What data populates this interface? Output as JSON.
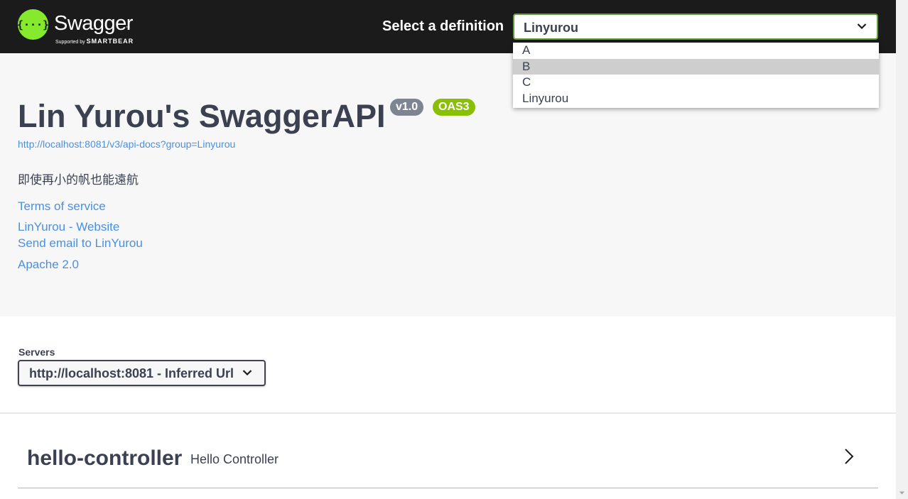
{
  "header": {
    "logo_word": "Swagger",
    "logo_tm": "™",
    "logo_sub_prefix": "Supported by",
    "logo_sub_brand": "SMARTBEAR",
    "definition_label": "Select a definition",
    "definition_value": "Linyurou",
    "definition_options": [
      "A",
      "B",
      "C",
      "Linyurou"
    ],
    "highlighted_option": "B"
  },
  "info": {
    "title": "Lin Yurou's SwaggerAPI",
    "version_badge": "v1.0",
    "oas_badge": "OAS3",
    "url": "http://localhost:8081/v3/api-docs?group=Linyurou",
    "description": "即使再小的帆也能遠航",
    "links": [
      "Terms of service",
      "LinYurou - Website",
      "Send email to LinYurou",
      "Apache 2.0"
    ]
  },
  "servers": {
    "label": "Servers",
    "selected": "http://localhost:8081 - Inferred Url"
  },
  "tags": [
    {
      "name": "hello-controller",
      "description": "Hello Controller"
    }
  ],
  "colors": {
    "topbar": "#1b1b1b",
    "brand_green": "#85ea2d",
    "link": "#4990e2",
    "version_badge": "#7d8492",
    "oas_badge": "#89bf04",
    "text": "#3b4151"
  }
}
